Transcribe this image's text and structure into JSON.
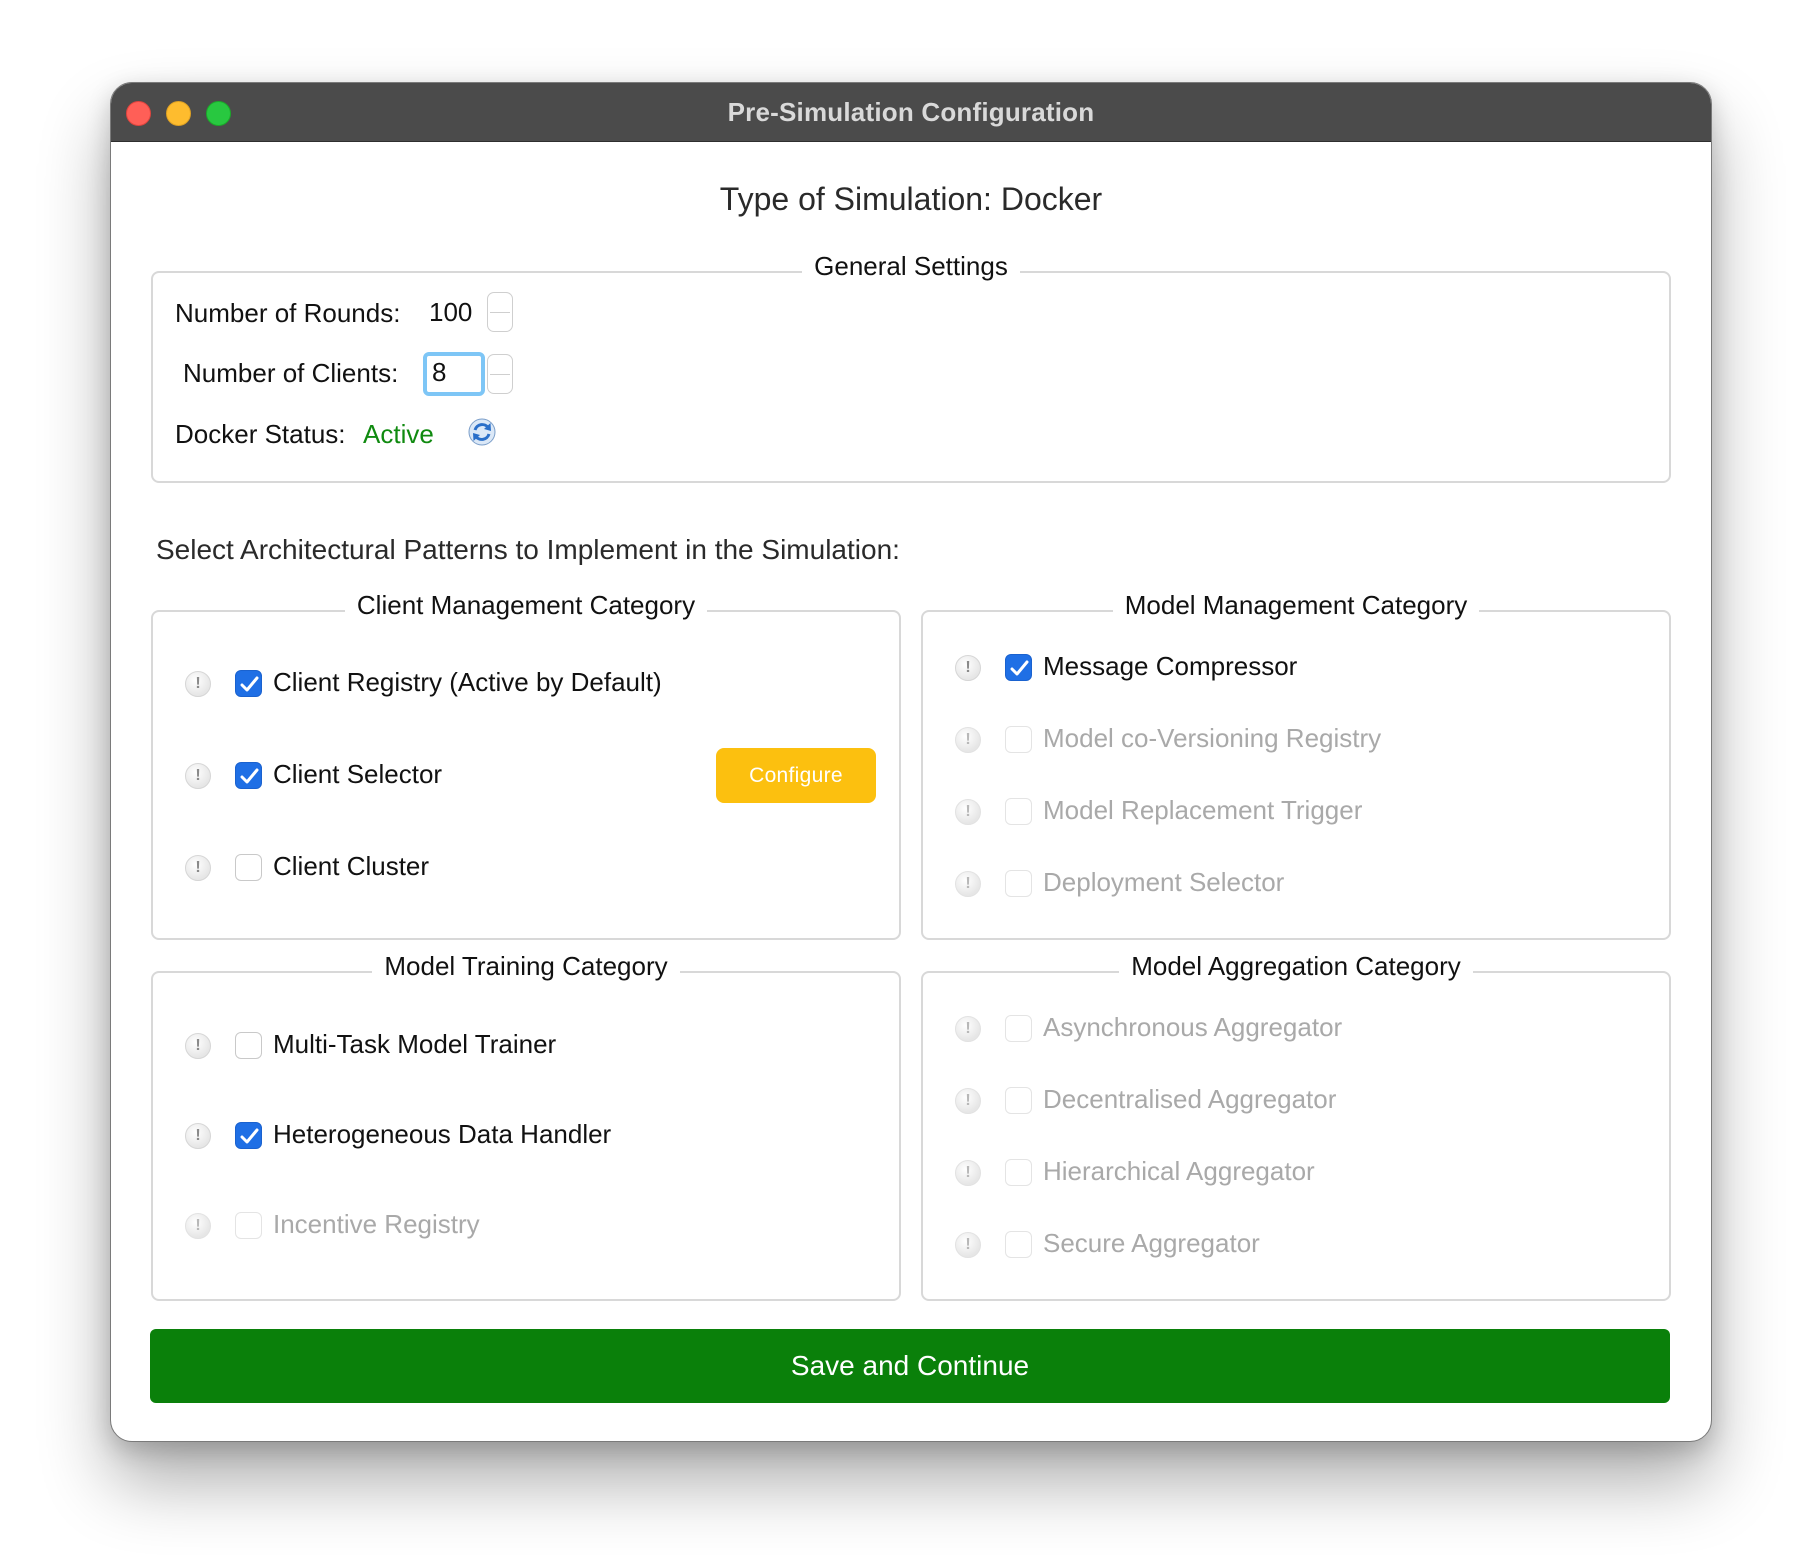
{
  "window": {
    "title": "Pre-Simulation Configuration"
  },
  "simulation_type": "Type of Simulation: Docker",
  "general_settings": {
    "title": "General Settings",
    "rounds_label": "Number of Rounds:",
    "rounds_value": "100",
    "clients_label": "Number of Clients:",
    "clients_value": "8",
    "docker_status_label": "Docker Status:",
    "docker_status_value": "Active",
    "refresh_icon": "refresh-icon"
  },
  "patterns_prompt": "Select Architectural Patterns to Implement in the Simulation:",
  "categories": {
    "client_management": {
      "title": "Client Management Category",
      "items": [
        {
          "label": "Client Registry (Active by Default)",
          "checked": true,
          "enabled": true
        },
        {
          "label": "Client Selector",
          "checked": true,
          "enabled": true
        },
        {
          "label": "Client Cluster",
          "checked": false,
          "enabled": true
        }
      ],
      "configure_label": "Configure"
    },
    "model_management": {
      "title": "Model Management Category",
      "items": [
        {
          "label": "Message Compressor",
          "checked": true,
          "enabled": true
        },
        {
          "label": "Model co-Versioning Registry",
          "checked": false,
          "enabled": false
        },
        {
          "label": "Model Replacement Trigger",
          "checked": false,
          "enabled": false
        },
        {
          "label": "Deployment Selector",
          "checked": false,
          "enabled": false
        }
      ]
    },
    "model_training": {
      "title": "Model Training Category",
      "items": [
        {
          "label": "Multi-Task Model Trainer",
          "checked": false,
          "enabled": true
        },
        {
          "label": "Heterogeneous Data Handler",
          "checked": true,
          "enabled": true
        },
        {
          "label": "Incentive Registry",
          "checked": false,
          "enabled": false
        }
      ]
    },
    "model_aggregation": {
      "title": "Model Aggregation Category",
      "items": [
        {
          "label": "Asynchronous Aggregator",
          "checked": false,
          "enabled": false
        },
        {
          "label": "Decentralised Aggregator",
          "checked": false,
          "enabled": false
        },
        {
          "label": "Hierarchical Aggregator",
          "checked": false,
          "enabled": false
        },
        {
          "label": "Secure Aggregator",
          "checked": false,
          "enabled": false
        }
      ]
    }
  },
  "info_icon_glyph": "!",
  "save_button_label": "Save and Continue",
  "colors": {
    "titlebar": "#4b4b4b",
    "checkbox_checked": "#1f6fe5",
    "status_active": "#108a10",
    "configure_button": "#fcc00f",
    "save_button": "#0a800a"
  }
}
